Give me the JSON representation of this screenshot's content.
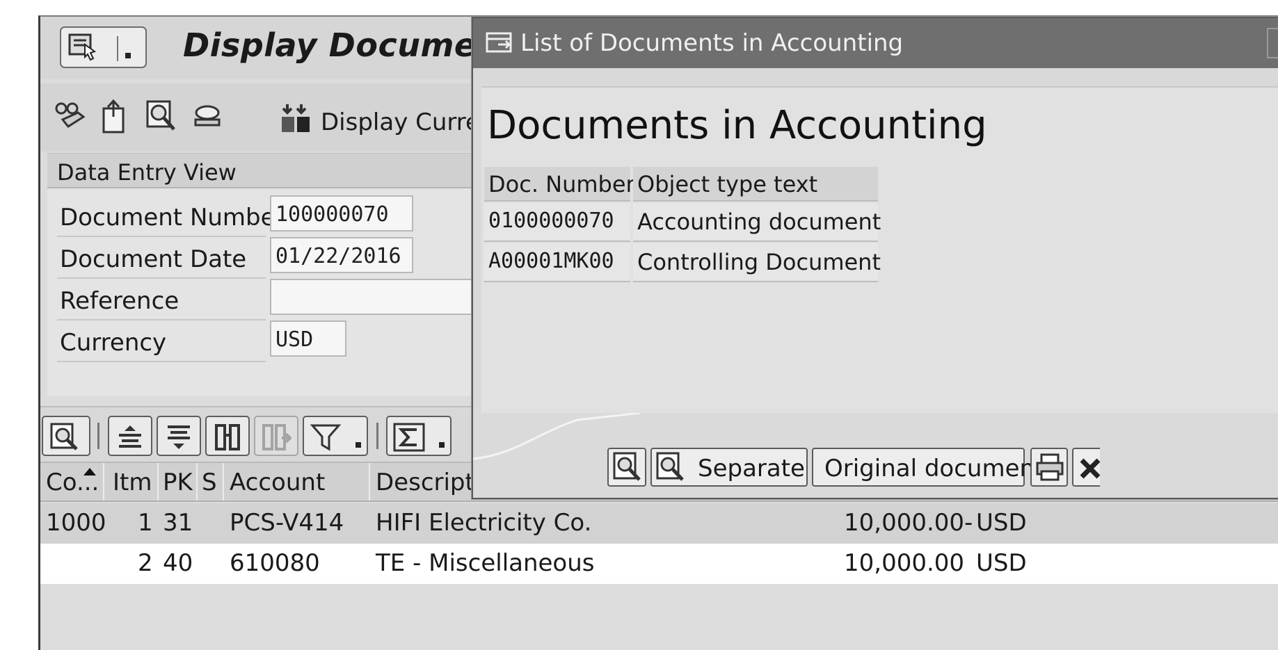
{
  "window": {
    "title": "Display Document:",
    "toolbar": {
      "display_currency_label": "Display Currency",
      "icons": [
        "glasses-icon",
        "document-export-icon",
        "magnifier-icon",
        "stamp-icon",
        "currency-icon"
      ]
    },
    "data_entry_view": {
      "header": "Data Entry View",
      "fields": [
        {
          "label": "Document Number",
          "value": "100000070"
        },
        {
          "label": "Document Date",
          "value": "01/22/2016"
        },
        {
          "label": "Reference",
          "value": ""
        },
        {
          "label": "Currency",
          "value": "USD"
        }
      ]
    },
    "line_items": {
      "columns": [
        "Co...",
        "Itm",
        "PK",
        "S",
        "Account",
        "Descriptic"
      ],
      "rows": [
        {
          "company_code": "1000",
          "item": "1",
          "posting_key": "31",
          "special": "",
          "account": "PCS-V414",
          "description": "HIFI Electricity Co.",
          "amount": "10,000.00-",
          "currency": "USD"
        },
        {
          "company_code": "",
          "item": "2",
          "posting_key": "40",
          "special": "",
          "account": "610080",
          "description": "TE - Miscellaneous",
          "amount": "10,000.00",
          "currency": "USD"
        }
      ]
    }
  },
  "dialog": {
    "title": "List of Documents in Accounting",
    "heading": "Documents in Accounting",
    "table": {
      "columns": [
        "Doc. Number",
        "Object type text"
      ],
      "rows": [
        {
          "doc_number": "0100000070",
          "object_type": "Accounting document"
        },
        {
          "doc_number": "A00001MK00",
          "object_type": "Controlling Document"
        }
      ]
    },
    "buttons": {
      "separate": "Separate",
      "original_document": "Original document"
    }
  }
}
